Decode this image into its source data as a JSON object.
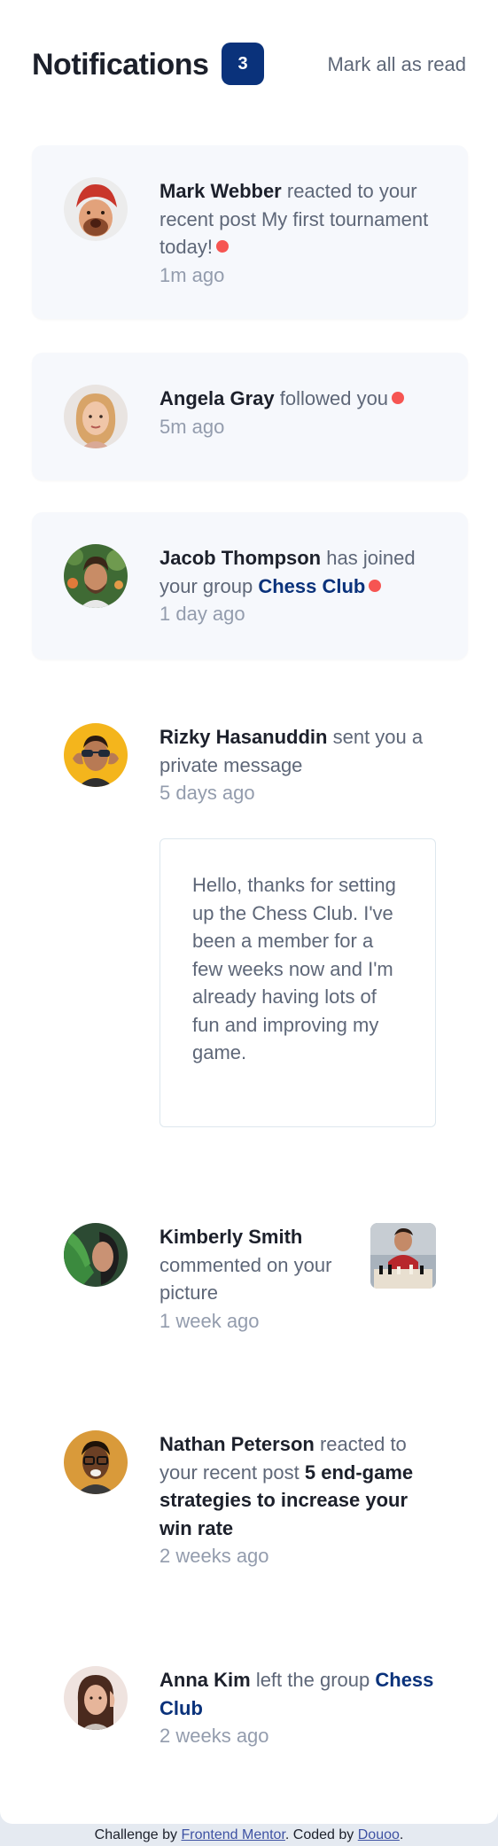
{
  "header": {
    "title": "Notifications",
    "badge_count": "3",
    "mark_all_label": "Mark all as read"
  },
  "notifications": [
    {
      "name": "Mark Webber",
      "action": "reacted to your recent post",
      "target": "My first tournament today!",
      "time": "1m ago",
      "unread": true
    },
    {
      "name": "Angela Gray",
      "action": "followed you",
      "time": "5m ago",
      "unread": true
    },
    {
      "name": "Jacob Thompson",
      "action": "has joined your group",
      "group": "Chess Club",
      "time": "1 day ago",
      "unread": true
    },
    {
      "name": "Rizky Hasanuddin",
      "action": "sent you a private message",
      "time": "5 days ago",
      "message": "Hello, thanks for setting up the Chess Club. I've been a member for a few weeks now and I'm already having lots of fun and improving my game.",
      "unread": false
    },
    {
      "name": "Kimberly Smith",
      "action": "commented on your picture",
      "time": "1 week ago",
      "unread": false
    },
    {
      "name": "Nathan Peterson",
      "action": "reacted to your recent post",
      "target": "5 end-game strategies to increase your win rate",
      "time": "2 weeks ago",
      "unread": false
    },
    {
      "name": "Anna Kim",
      "action": "left the group",
      "group": "Chess Club",
      "time": "2 weeks ago",
      "unread": false
    }
  ],
  "footer": {
    "prefix": "Challenge by",
    "challenge_link": "Frontend Mentor",
    "middle": ". Coded by",
    "author_link": "Douoo",
    "suffix": "."
  },
  "colors": {
    "accent": "#0a327b",
    "unread_dot": "#f65552",
    "unread_bg": "#f6f8fc",
    "heading": "#1c202b",
    "text": "#5e6778",
    "muted": "#939cad"
  }
}
